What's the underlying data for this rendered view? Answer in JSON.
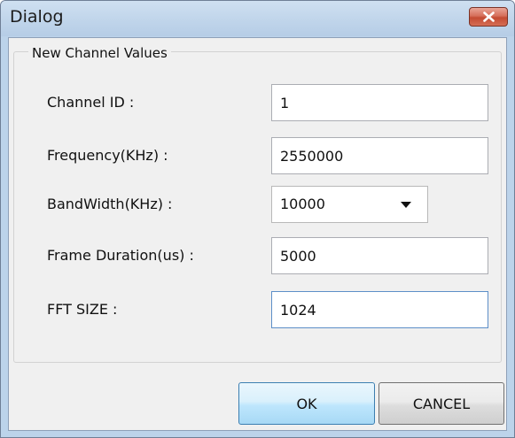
{
  "window": {
    "title": "Dialog"
  },
  "group": {
    "title": "New Channel Values"
  },
  "fields": {
    "channel_id": {
      "label": "Channel ID :",
      "value": "1"
    },
    "frequency": {
      "label": "Frequency(KHz) :",
      "value": "2550000"
    },
    "bandwidth": {
      "label": "BandWidth(KHz) :",
      "value": "10000"
    },
    "frame_duration": {
      "label": "Frame Duration(us) :",
      "value": "5000"
    },
    "fft_size": {
      "label": "FFT SIZE :",
      "value": "1024"
    }
  },
  "buttons": {
    "ok": "OK",
    "cancel": "CANCEL"
  },
  "icons": {
    "close": "close-icon",
    "dropdown": "chevron-down-icon"
  },
  "colors": {
    "titlebar": "#bfd4ea",
    "close_button": "#c44b32",
    "dialog_background": "#f0f0f0"
  }
}
